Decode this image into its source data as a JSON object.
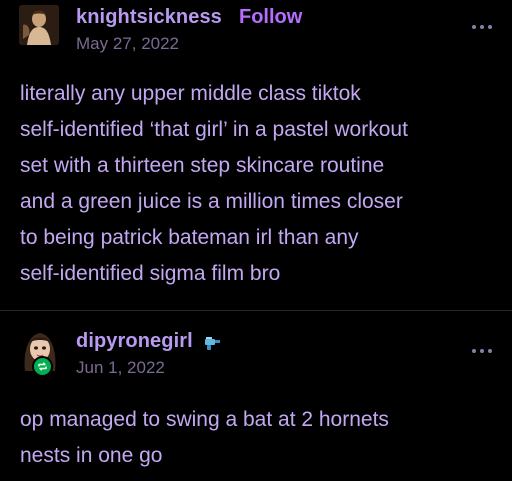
{
  "post1": {
    "username": "knightsickness",
    "follow_label": "Follow",
    "date": "May 27, 2022",
    "avatar_icon": "painting-avatar-icon",
    "more_icon": "more-options-icon",
    "text": "literally any upper middle class tiktok\nself-identified ‘that girl’ in a pastel workout\nset with a thirteen step skincare routine\nand a green juice is a million times closer\nto being patrick bateman irl than any\nself-identified sigma film bro"
  },
  "post2": {
    "username": "dipyronegirl",
    "date": "Jun 1, 2022",
    "avatar_icon": "cartoon-girl-avatar-icon",
    "reblog_icon": "reblog-icon",
    "user_badge_icon": "water-gun-badge-icon",
    "more_icon": "more-options-icon",
    "text": "op managed to swing a bat at 2 hornets\nnests in one go"
  },
  "colors": {
    "background": "#000000",
    "text": "#c2a8f2",
    "follow": "#b56dff",
    "date": "#7a6b92",
    "reblog_badge": "#00b050"
  }
}
